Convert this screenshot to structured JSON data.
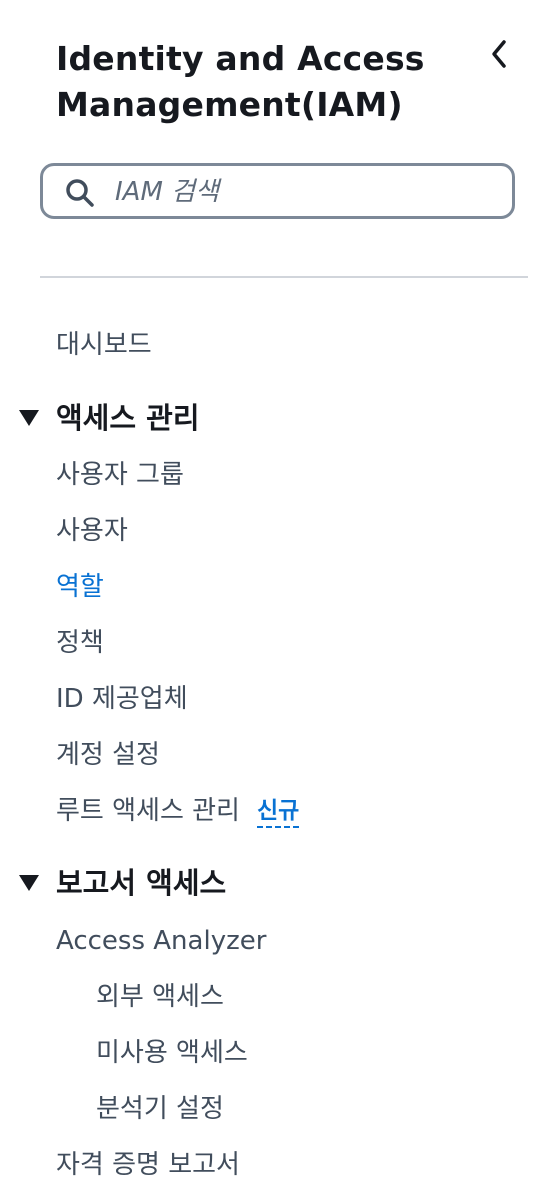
{
  "header": {
    "title": "Identity and Access Management(IAM)"
  },
  "search": {
    "placeholder": "IAM 검색",
    "value": ""
  },
  "nav": {
    "dashboard": "대시보드",
    "access_management": {
      "label": "액세스 관리",
      "items": {
        "user_groups": "사용자 그룹",
        "users": "사용자",
        "roles": "역할",
        "policies": "정책",
        "identity_providers": "ID 제공업체",
        "account_settings": "계정 설정",
        "root_access_management": "루트 액세스 관리"
      },
      "new_badge": "신규"
    },
    "access_reports": {
      "label": "보고서 액세스",
      "items": {
        "access_analyzer": "Access Analyzer",
        "external_access": "외부 액세스",
        "unused_access": "미사용 액세스",
        "analyzer_settings": "분석기 설정",
        "credential_report": "자격 증명 보고서"
      }
    }
  },
  "colors": {
    "active_link": "#0972d3",
    "text": "#16191f",
    "muted_text": "#414d5c",
    "border": "#7d8998"
  },
  "icons": {
    "collapse": "chevron-left-icon",
    "search": "search-icon",
    "section_expanded": "caret-down-icon"
  }
}
